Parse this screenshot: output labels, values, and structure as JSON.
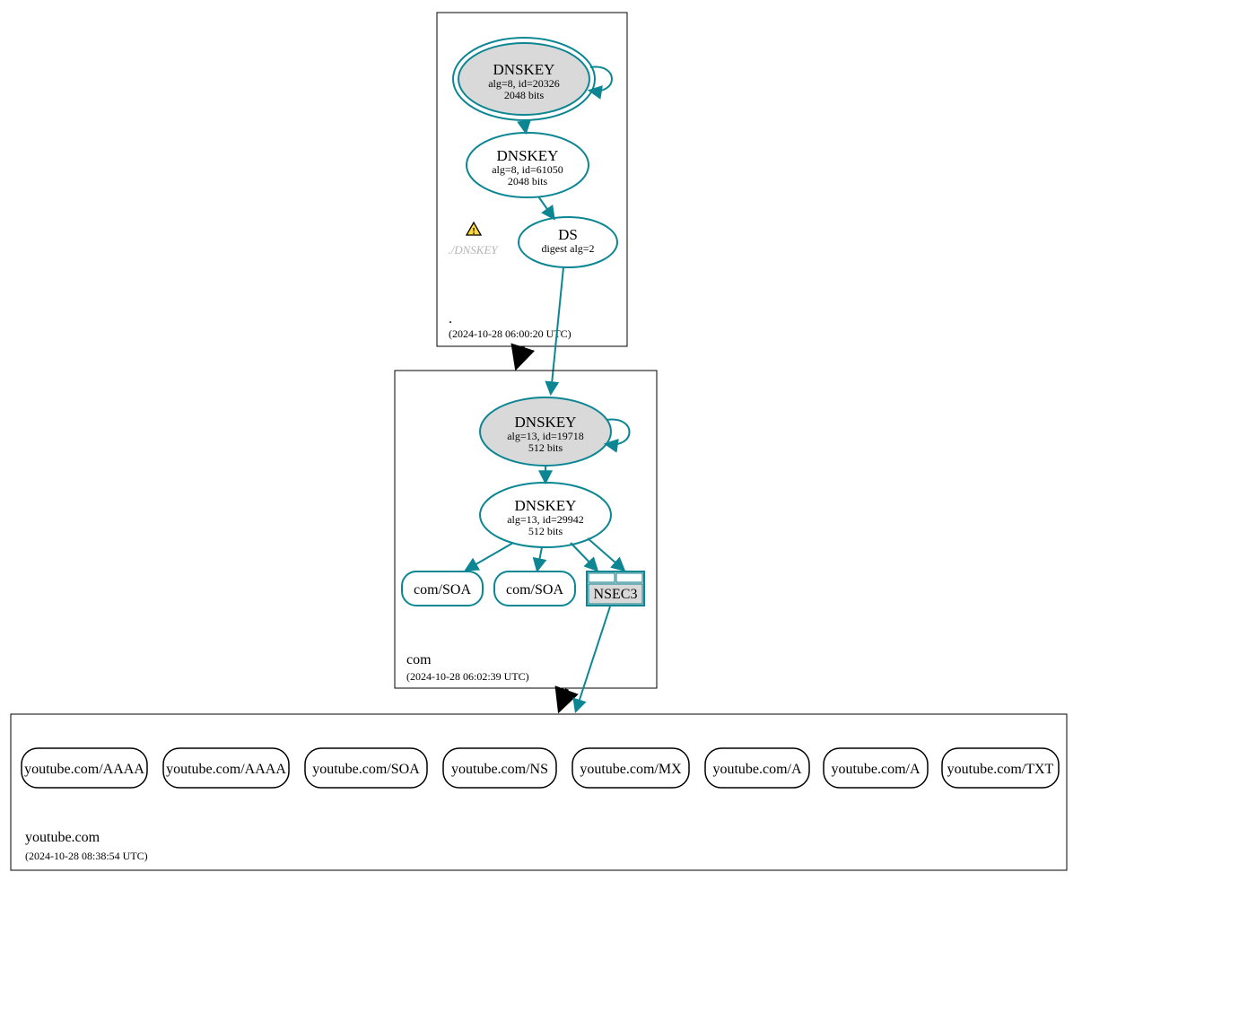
{
  "zones": {
    "root": {
      "name": ".",
      "timestamp": "(2024-10-28 06:00:20 UTC)"
    },
    "com": {
      "name": "com",
      "timestamp": "(2024-10-28 06:02:39 UTC)"
    },
    "youtube": {
      "name": "youtube.com",
      "timestamp": "(2024-10-28 08:38:54 UTC)"
    }
  },
  "nodes": {
    "root_ksk": {
      "title": "DNSKEY",
      "line2": "alg=8, id=20326",
      "line3": "2048 bits"
    },
    "root_zsk": {
      "title": "DNSKEY",
      "line2": "alg=8, id=61050",
      "line3": "2048 bits"
    },
    "root_ds": {
      "title": "DS",
      "line2": "digest alg=2"
    },
    "root_missing": {
      "label": "./DNSKEY"
    },
    "com_ksk": {
      "title": "DNSKEY",
      "line2": "alg=13, id=19718",
      "line3": "512 bits"
    },
    "com_zsk": {
      "title": "DNSKEY",
      "line2": "alg=13, id=29942",
      "line3": "512 bits"
    },
    "com_soa1": {
      "label": "com/SOA"
    },
    "com_soa2": {
      "label": "com/SOA"
    },
    "nsec3": {
      "label": "NSEC3"
    },
    "yt_aaaa1": {
      "label": "youtube.com/AAAA"
    },
    "yt_aaaa2": {
      "label": "youtube.com/AAAA"
    },
    "yt_soa": {
      "label": "youtube.com/SOA"
    },
    "yt_ns": {
      "label": "youtube.com/NS"
    },
    "yt_mx": {
      "label": "youtube.com/MX"
    },
    "yt_a1": {
      "label": "youtube.com/A"
    },
    "yt_a2": {
      "label": "youtube.com/A"
    },
    "yt_txt": {
      "label": "youtube.com/TXT"
    }
  }
}
